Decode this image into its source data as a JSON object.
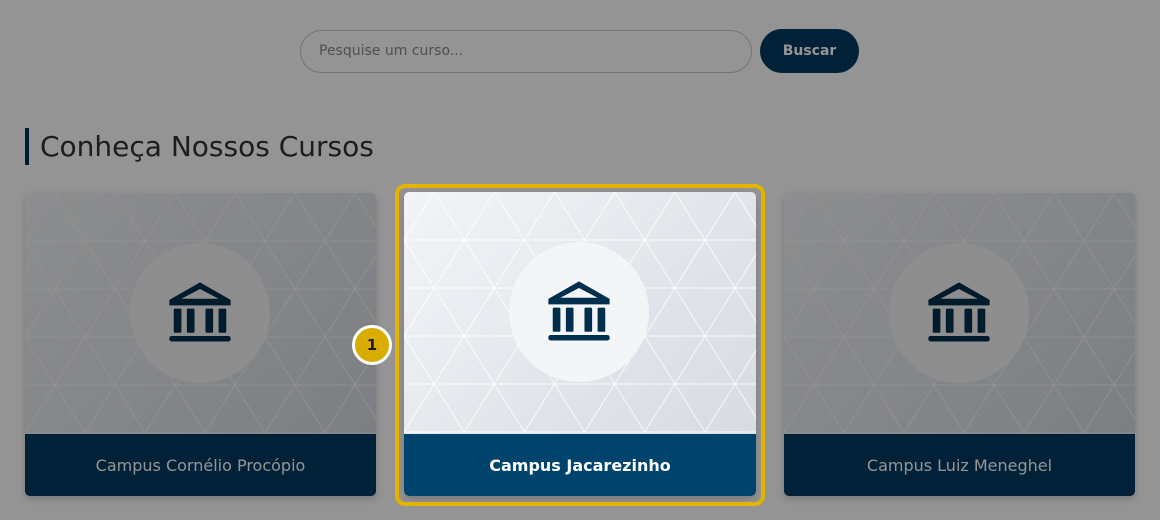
{
  "search": {
    "placeholder": "Pesquise um curso...",
    "value": "",
    "button_label": "Buscar"
  },
  "section": {
    "title": "Conheça Nossos Cursos"
  },
  "cards": [
    {
      "label": "Campus Cornélio Procópio",
      "icon": "bank-icon"
    },
    {
      "label": "Campus Jacarezinho",
      "icon": "bank-icon"
    },
    {
      "label": "Campus Luiz Meneghel",
      "icon": "bank-icon"
    }
  ],
  "tour": {
    "step_number": "1",
    "highlighted_card": "Campus Jacarezinho",
    "highlight_color": "#e2b400"
  },
  "colors": {
    "brand_navy": "#003a5f",
    "card_label_active": "#00446e",
    "marker": "#d8ad00"
  }
}
